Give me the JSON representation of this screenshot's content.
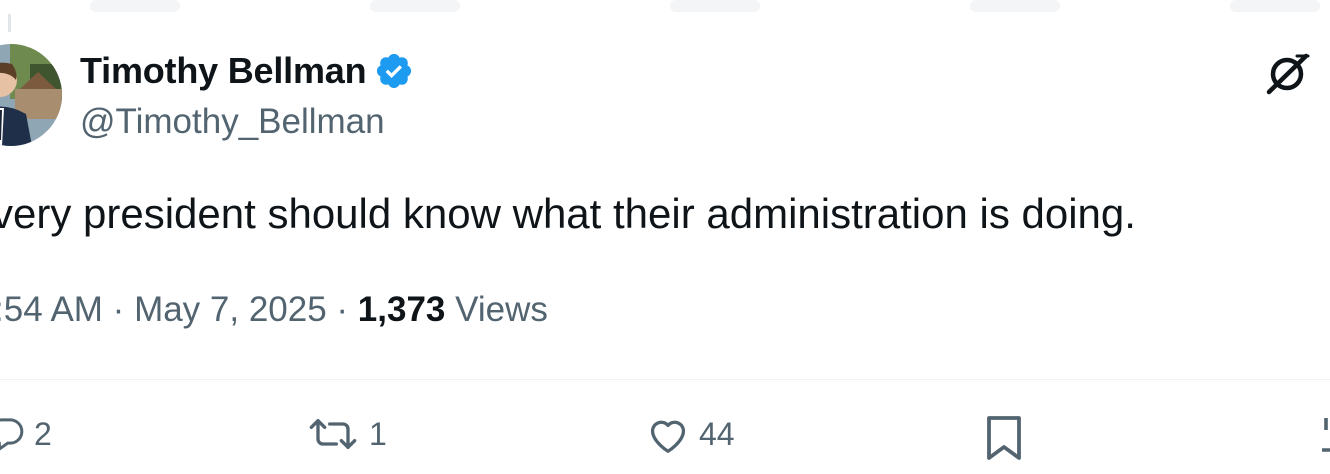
{
  "author": {
    "display_name": "Timothy Bellman",
    "handle": "@Timothy_Bellman",
    "verified": true
  },
  "tweet": {
    "text": "very president should know what their administration is doing.",
    "time": ":54 AM",
    "separator1": " · ",
    "date": "May 7, 2025",
    "separator2": " · ",
    "views_count": "1,373",
    "views_label": " Views"
  },
  "actions": {
    "replies": "2",
    "reposts": "1",
    "likes": "44"
  },
  "icons": {
    "verified": "verified-badge-icon",
    "grok": "grok-icon",
    "reply": "reply-icon",
    "repost": "repost-icon",
    "like": "heart-icon",
    "bookmark": "bookmark-icon",
    "share": "share-icon"
  },
  "colors": {
    "verified_blue": "#1d9bf0",
    "text_primary": "#0f1419",
    "text_secondary": "#536471"
  }
}
